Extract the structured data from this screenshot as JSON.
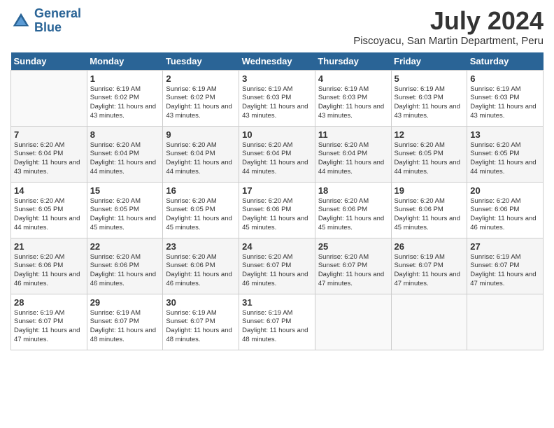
{
  "header": {
    "logo_line1": "General",
    "logo_line2": "Blue",
    "main_title": "July 2024",
    "subtitle": "Piscoyacu, San Martin Department, Peru"
  },
  "days_of_week": [
    "Sunday",
    "Monday",
    "Tuesday",
    "Wednesday",
    "Thursday",
    "Friday",
    "Saturday"
  ],
  "weeks": [
    [
      {
        "day": "",
        "info": ""
      },
      {
        "day": "1",
        "info": "Sunrise: 6:19 AM\nSunset: 6:02 PM\nDaylight: 11 hours\nand 43 minutes."
      },
      {
        "day": "2",
        "info": "Sunrise: 6:19 AM\nSunset: 6:02 PM\nDaylight: 11 hours\nand 43 minutes."
      },
      {
        "day": "3",
        "info": "Sunrise: 6:19 AM\nSunset: 6:03 PM\nDaylight: 11 hours\nand 43 minutes."
      },
      {
        "day": "4",
        "info": "Sunrise: 6:19 AM\nSunset: 6:03 PM\nDaylight: 11 hours\nand 43 minutes."
      },
      {
        "day": "5",
        "info": "Sunrise: 6:19 AM\nSunset: 6:03 PM\nDaylight: 11 hours\nand 43 minutes."
      },
      {
        "day": "6",
        "info": "Sunrise: 6:19 AM\nSunset: 6:03 PM\nDaylight: 11 hours\nand 43 minutes."
      }
    ],
    [
      {
        "day": "7",
        "info": "Sunrise: 6:20 AM\nSunset: 6:04 PM\nDaylight: 11 hours\nand 43 minutes."
      },
      {
        "day": "8",
        "info": "Sunrise: 6:20 AM\nSunset: 6:04 PM\nDaylight: 11 hours\nand 44 minutes."
      },
      {
        "day": "9",
        "info": "Sunrise: 6:20 AM\nSunset: 6:04 PM\nDaylight: 11 hours\nand 44 minutes."
      },
      {
        "day": "10",
        "info": "Sunrise: 6:20 AM\nSunset: 6:04 PM\nDaylight: 11 hours\nand 44 minutes."
      },
      {
        "day": "11",
        "info": "Sunrise: 6:20 AM\nSunset: 6:04 PM\nDaylight: 11 hours\nand 44 minutes."
      },
      {
        "day": "12",
        "info": "Sunrise: 6:20 AM\nSunset: 6:05 PM\nDaylight: 11 hours\nand 44 minutes."
      },
      {
        "day": "13",
        "info": "Sunrise: 6:20 AM\nSunset: 6:05 PM\nDaylight: 11 hours\nand 44 minutes."
      }
    ],
    [
      {
        "day": "14",
        "info": "Sunrise: 6:20 AM\nSunset: 6:05 PM\nDaylight: 11 hours\nand 44 minutes."
      },
      {
        "day": "15",
        "info": "Sunrise: 6:20 AM\nSunset: 6:05 PM\nDaylight: 11 hours\nand 45 minutes."
      },
      {
        "day": "16",
        "info": "Sunrise: 6:20 AM\nSunset: 6:05 PM\nDaylight: 11 hours\nand 45 minutes."
      },
      {
        "day": "17",
        "info": "Sunrise: 6:20 AM\nSunset: 6:06 PM\nDaylight: 11 hours\nand 45 minutes."
      },
      {
        "day": "18",
        "info": "Sunrise: 6:20 AM\nSunset: 6:06 PM\nDaylight: 11 hours\nand 45 minutes."
      },
      {
        "day": "19",
        "info": "Sunrise: 6:20 AM\nSunset: 6:06 PM\nDaylight: 11 hours\nand 45 minutes."
      },
      {
        "day": "20",
        "info": "Sunrise: 6:20 AM\nSunset: 6:06 PM\nDaylight: 11 hours\nand 46 minutes."
      }
    ],
    [
      {
        "day": "21",
        "info": "Sunrise: 6:20 AM\nSunset: 6:06 PM\nDaylight: 11 hours\nand 46 minutes."
      },
      {
        "day": "22",
        "info": "Sunrise: 6:20 AM\nSunset: 6:06 PM\nDaylight: 11 hours\nand 46 minutes."
      },
      {
        "day": "23",
        "info": "Sunrise: 6:20 AM\nSunset: 6:06 PM\nDaylight: 11 hours\nand 46 minutes."
      },
      {
        "day": "24",
        "info": "Sunrise: 6:20 AM\nSunset: 6:07 PM\nDaylight: 11 hours\nand 46 minutes."
      },
      {
        "day": "25",
        "info": "Sunrise: 6:20 AM\nSunset: 6:07 PM\nDaylight: 11 hours\nand 47 minutes."
      },
      {
        "day": "26",
        "info": "Sunrise: 6:19 AM\nSunset: 6:07 PM\nDaylight: 11 hours\nand 47 minutes."
      },
      {
        "day": "27",
        "info": "Sunrise: 6:19 AM\nSunset: 6:07 PM\nDaylight: 11 hours\nand 47 minutes."
      }
    ],
    [
      {
        "day": "28",
        "info": "Sunrise: 6:19 AM\nSunset: 6:07 PM\nDaylight: 11 hours\nand 47 minutes."
      },
      {
        "day": "29",
        "info": "Sunrise: 6:19 AM\nSunset: 6:07 PM\nDaylight: 11 hours\nand 48 minutes."
      },
      {
        "day": "30",
        "info": "Sunrise: 6:19 AM\nSunset: 6:07 PM\nDaylight: 11 hours\nand 48 minutes."
      },
      {
        "day": "31",
        "info": "Sunrise: 6:19 AM\nSunset: 6:07 PM\nDaylight: 11 hours\nand 48 minutes."
      },
      {
        "day": "",
        "info": ""
      },
      {
        "day": "",
        "info": ""
      },
      {
        "day": "",
        "info": ""
      }
    ]
  ]
}
